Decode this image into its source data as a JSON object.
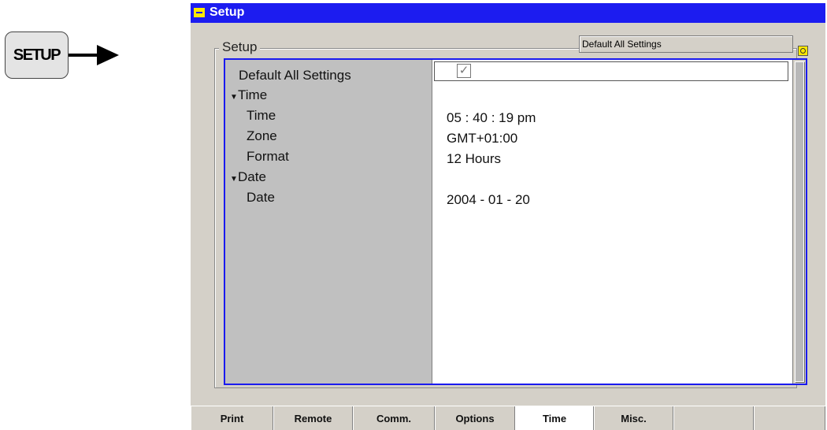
{
  "hardkey": {
    "label": "SETUP"
  },
  "window": {
    "title": "Setup",
    "group_label": "Setup",
    "default_button": "Default All Settings"
  },
  "rows": [
    {
      "label": "Default All Settings",
      "value": "",
      "indent": 1,
      "checkbox": "✓"
    },
    {
      "label": "Time",
      "value": "",
      "indent": 0,
      "expanded": true
    },
    {
      "label": "Time",
      "value": "05 : 40 : 19  pm",
      "indent": 2
    },
    {
      "label": "Zone",
      "value": "GMT+01:00",
      "indent": 2
    },
    {
      "label": "Format",
      "value": "12 Hours",
      "indent": 2
    },
    {
      "label": "Date",
      "value": "",
      "indent": 0,
      "expanded": true
    },
    {
      "label": "Date",
      "value": "2004 - 01 - 20",
      "indent": 2
    }
  ],
  "softkeys": [
    "Print",
    "Remote",
    "Comm.",
    "Options",
    "Time",
    "Misc.",
    "",
    ""
  ],
  "active_softkey": "Time",
  "colors": {
    "title_bar": "#1c1cf0",
    "highlight": "#1a1aef",
    "panel": "#d4d0c8",
    "icon_yellow": "#ffe800"
  }
}
